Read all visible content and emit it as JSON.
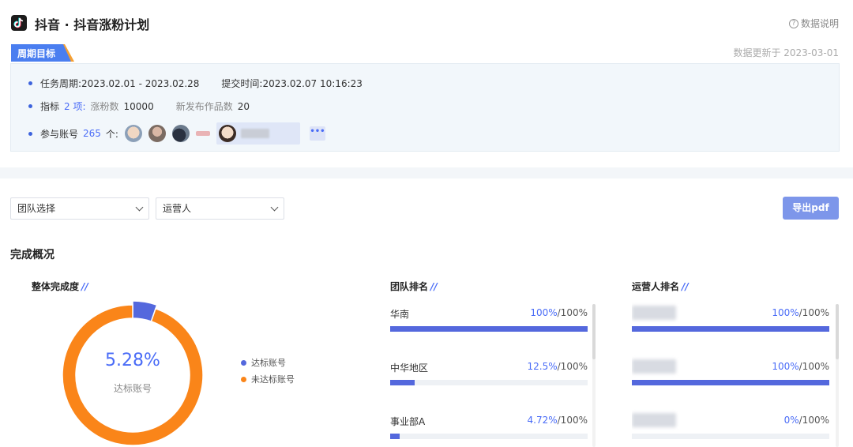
{
  "header": {
    "title": "抖音 · 抖音涨粉计划",
    "help_label": "数据说明"
  },
  "period": {
    "tag": "周期目标",
    "update_time": "数据更新于 2023-03-01"
  },
  "info": {
    "cycle_label": "任务周期:",
    "cycle_value": "2023.02.01 - 2023.02.28",
    "submit_label": "提交时间:",
    "submit_value": "2023.02.07 10:16:23",
    "metric_label": "指标",
    "metric_count": "2 项:",
    "metric1_name": "涨粉数",
    "metric1_value": "10000",
    "metric2_name": "新发布作品数",
    "metric2_value": "20",
    "accounts_label": "参与账号",
    "accounts_count": "265",
    "accounts_suffix": "个:",
    "more_label": "•••"
  },
  "filters": {
    "team_select": "团队选择",
    "operator_select": "运营人",
    "export_label": "导出pdf"
  },
  "section": {
    "title": "完成概况",
    "overall_title": "整体完成度",
    "team_title": "团队排名",
    "operator_title": "运营人排名",
    "title_mark": "//"
  },
  "overall": {
    "percent_label": "5.28%",
    "sub_label": "达标账号",
    "legend_met": "达标账号",
    "legend_unmet": "未达标账号"
  },
  "team_rank": [
    {
      "name": "华南",
      "pct": "100%",
      "total": "/100%",
      "fill": 100
    },
    {
      "name": "中华地区",
      "pct": "12.5%",
      "total": "/100%",
      "fill": 12.5
    },
    {
      "name": "事业部A",
      "pct": "4.72%",
      "total": "/100%",
      "fill": 4.72
    }
  ],
  "operator_rank": [
    {
      "pct": "100%",
      "total": "/100%",
      "fill": 100
    },
    {
      "pct": "100%",
      "total": "/100%",
      "fill": 100
    },
    {
      "pct": "0%",
      "total": "/100%",
      "fill": 0
    }
  ],
  "colors": {
    "met": "#5468dd",
    "unmet": "#fa8519",
    "accent": "#4a6cf7"
  },
  "chart_data": {
    "type": "pie",
    "categories": [
      "达标账号",
      "未达标账号"
    ],
    "values": [
      5.28,
      94.72
    ]
  }
}
